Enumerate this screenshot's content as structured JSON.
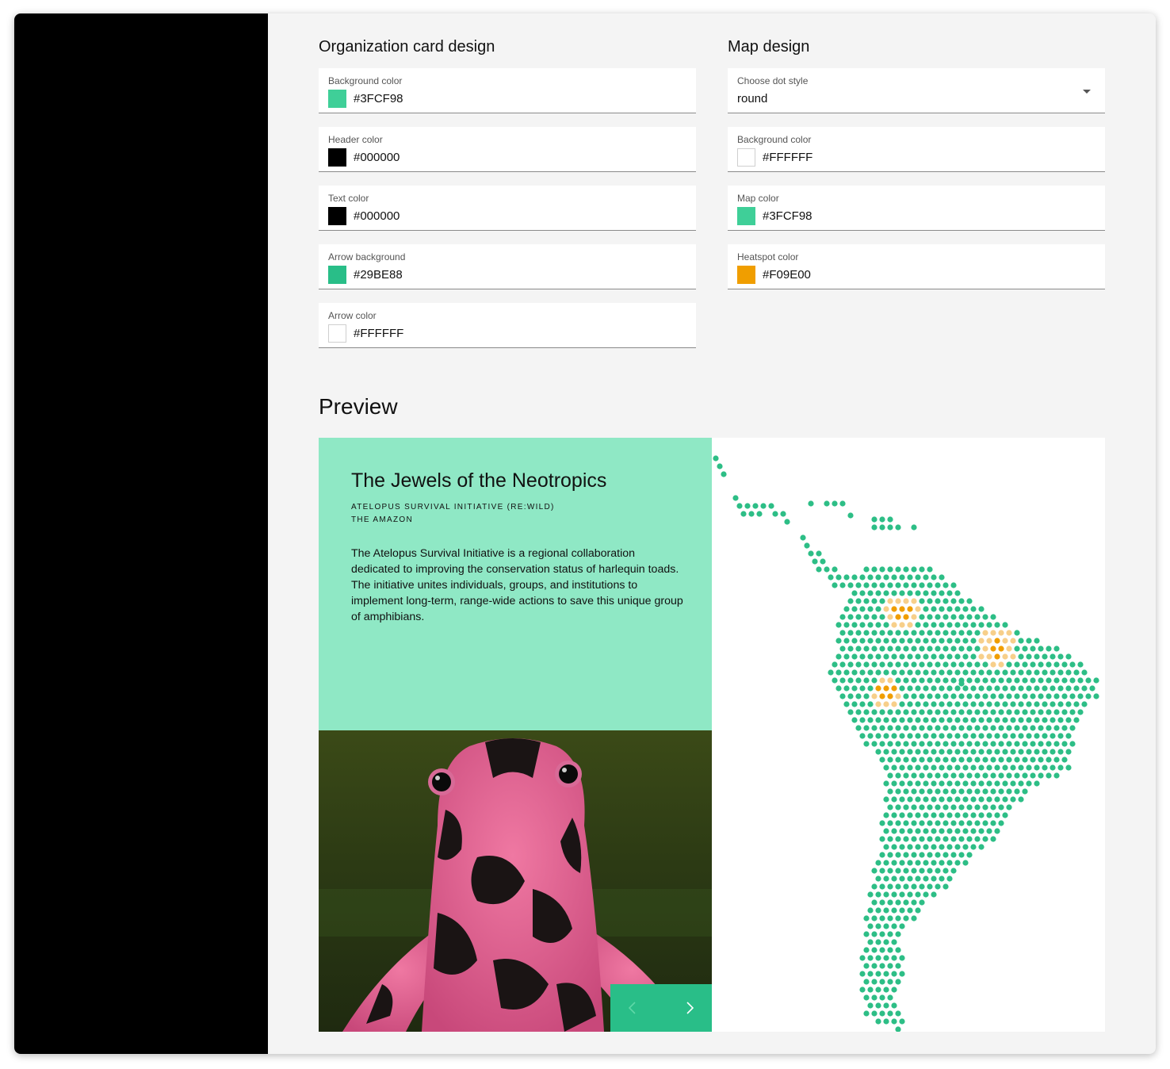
{
  "org_card": {
    "title": "Organization card design",
    "fields": [
      {
        "label": "Background color",
        "value": "#3FCF98",
        "swatch": "#3FCF98"
      },
      {
        "label": "Header color",
        "value": "#000000",
        "swatch": "#000000"
      },
      {
        "label": "Text color",
        "value": "#000000",
        "swatch": "#000000"
      },
      {
        "label": "Arrow background",
        "value": "#29BE88",
        "swatch": "#29BE88"
      },
      {
        "label": "Arrow color",
        "value": "#FFFFFF",
        "swatch": "#FFFFFF"
      }
    ]
  },
  "map_design": {
    "title": "Map design",
    "dot_style": {
      "label": "Choose dot style",
      "value": "round"
    },
    "fields": [
      {
        "label": "Background color",
        "value": "#FFFFFF",
        "swatch": "#FFFFFF"
      },
      {
        "label": "Map color",
        "value": "#3FCF98",
        "swatch": "#3FCF98"
      },
      {
        "label": "Heatspot color",
        "value": "#F09E00",
        "swatch": "#F09E00"
      }
    ]
  },
  "preview": {
    "title": "Preview",
    "card": {
      "title": "The Jewels of the Neotropics",
      "organization": "ATELOPUS SURVIVAL INITIATIVE (RE:WILD)",
      "region": "THE AMAZON",
      "description": "The Atelopus Survival Initiative is a regional collaboration dedicated to improving the conservation status of harlequin toads. The initiative unites individuals, groups, and institutions to implement long-term, range-wide actions to save this unique group of amphibians."
    },
    "card_bg": "#8FE8C5",
    "arrow_bg": "#29BE88",
    "map_dot_color": "#2DBE86",
    "heat_color": "#F09E00",
    "heat_light": "#F7CF8A"
  }
}
